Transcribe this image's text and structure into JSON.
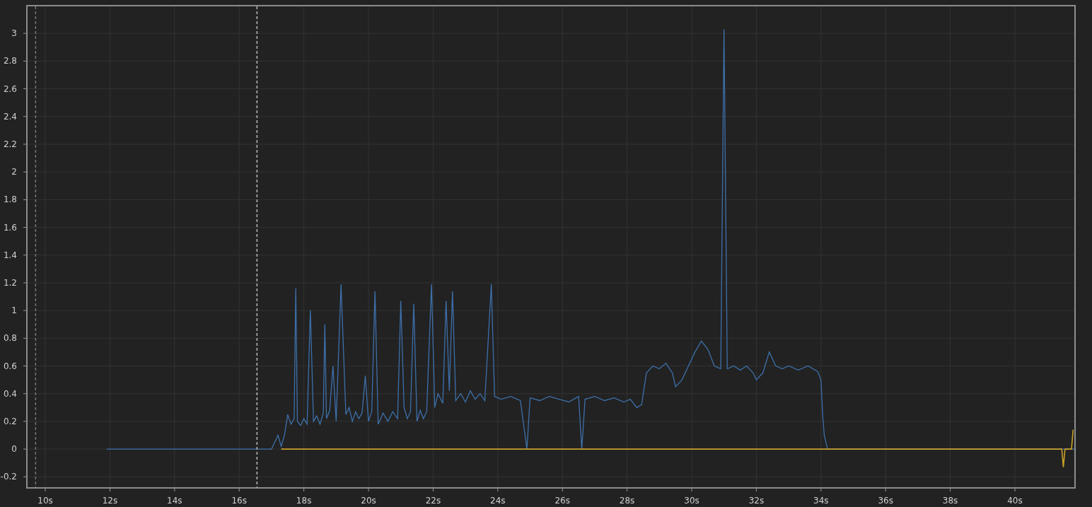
{
  "chart_data": {
    "type": "line",
    "x": [
      11.9,
      17.0,
      17.2,
      17.3,
      17.4,
      17.5,
      17.6,
      17.7,
      17.75,
      17.8,
      17.9,
      18.0,
      18.1,
      18.2,
      18.3,
      18.4,
      18.5,
      18.6,
      18.65,
      18.7,
      18.8,
      18.9,
      19.0,
      19.15,
      19.3,
      19.4,
      19.5,
      19.6,
      19.7,
      19.8,
      19.9,
      20.0,
      20.1,
      20.2,
      20.3,
      20.45,
      20.6,
      20.75,
      20.9,
      21.0,
      21.1,
      21.2,
      21.3,
      21.4,
      21.5,
      21.6,
      21.7,
      21.8,
      21.95,
      22.05,
      22.15,
      22.3,
      22.4,
      22.5,
      22.6,
      22.7,
      22.85,
      23.0,
      23.15,
      23.3,
      23.45,
      23.6,
      23.8,
      23.9,
      24.1,
      24.4,
      24.7,
      24.9,
      25.0,
      25.3,
      25.6,
      25.9,
      26.2,
      26.5,
      26.6,
      26.7,
      27.0,
      27.3,
      27.6,
      27.9,
      28.1,
      28.3,
      28.45,
      28.6,
      28.8,
      29.0,
      29.2,
      29.4,
      29.5,
      29.7,
      29.9,
      30.1,
      30.3,
      30.5,
      30.7,
      30.9,
      31.0,
      31.1,
      31.3,
      31.5,
      31.7,
      31.9,
      32.0,
      32.2,
      32.4,
      32.6,
      32.8,
      33.0,
      33.3,
      33.6,
      33.9,
      34.0,
      34.05,
      34.1,
      34.2,
      41.45,
      41.5,
      41.55,
      41.75,
      41.8,
      41.85
    ],
    "series": [
      {
        "color": "#3d70aa",
        "values": [
          0,
          0,
          0.1,
          0.02,
          0.1,
          0.25,
          0.18,
          0.22,
          1.16,
          0.2,
          0.17,
          0.22,
          0.18,
          1.0,
          0.2,
          0.24,
          0.18,
          0.26,
          0.9,
          0.22,
          0.28,
          0.6,
          0.2,
          1.19,
          0.25,
          0.3,
          0.2,
          0.27,
          0.22,
          0.26,
          0.53,
          0.2,
          0.27,
          1.14,
          0.18,
          0.26,
          0.2,
          0.27,
          0.22,
          1.07,
          0.3,
          0.22,
          0.27,
          1.05,
          0.2,
          0.28,
          0.22,
          0.27,
          1.19,
          0.3,
          0.4,
          0.33,
          1.07,
          0.42,
          1.14,
          0.35,
          0.4,
          0.34,
          0.42,
          0.36,
          0.4,
          0.35,
          1.19,
          0.38,
          0.36,
          0.38,
          0.35,
          0,
          0.37,
          0.35,
          0.38,
          0.36,
          0.34,
          0.38,
          0,
          0.36,
          0.38,
          0.35,
          0.37,
          0.34,
          0.36,
          0.3,
          0.32,
          0.55,
          0.6,
          0.58,
          0.62,
          0.55,
          0.45,
          0.5,
          0.6,
          0.7,
          0.78,
          0.72,
          0.6,
          0.58,
          3.03,
          0.58,
          0.6,
          0.57,
          0.6,
          0.55,
          0.5,
          0.55,
          0.7,
          0.6,
          0.58,
          0.6,
          0.57,
          0.6,
          0.56,
          0.5,
          0.25,
          0.1,
          0,
          0,
          0,
          0,
          0,
          0,
          0
        ]
      },
      {
        "color": "#c9a02a",
        "values": [
          null,
          null,
          null,
          0,
          0,
          0,
          0,
          0,
          0,
          0,
          0,
          0,
          0,
          0,
          0,
          0,
          0,
          0,
          0,
          0,
          0,
          0,
          0,
          0,
          0,
          0,
          0,
          0,
          0,
          0,
          0,
          0,
          0,
          0,
          0,
          0,
          0,
          0,
          0,
          0,
          0,
          0,
          0,
          0,
          0,
          0,
          0,
          0,
          0,
          0,
          0,
          0,
          0,
          0,
          0,
          0,
          0,
          0,
          0,
          0,
          0,
          0,
          0,
          0,
          0,
          0,
          0,
          0,
          0,
          0,
          0,
          0,
          0,
          0,
          0,
          0,
          0,
          0,
          0,
          0,
          0,
          0,
          0,
          0,
          0,
          0,
          0,
          0,
          0,
          0,
          0,
          0,
          0,
          0,
          0,
          0,
          0,
          0,
          0,
          0,
          0,
          0,
          0,
          0,
          0,
          0,
          0,
          0,
          0,
          0,
          0,
          0,
          0,
          0,
          0,
          0,
          -0.13,
          0,
          0,
          0.14,
          null
        ]
      }
    ],
    "xlim": [
      9.43,
      41.86
    ],
    "ylim": [
      -0.28,
      3.2
    ],
    "xticks": [
      {
        "value": 10,
        "label": "10s"
      },
      {
        "value": 12,
        "label": "12s"
      },
      {
        "value": 14,
        "label": "14s"
      },
      {
        "value": 16,
        "label": "16s"
      },
      {
        "value": 18,
        "label": "18s"
      },
      {
        "value": 20,
        "label": "20s"
      },
      {
        "value": 22,
        "label": "22s"
      },
      {
        "value": 24,
        "label": "24s"
      },
      {
        "value": 26,
        "label": "26s"
      },
      {
        "value": 28,
        "label": "28s"
      },
      {
        "value": 30,
        "label": "30s"
      },
      {
        "value": 32,
        "label": "32s"
      },
      {
        "value": 34,
        "label": "34s"
      },
      {
        "value": 36,
        "label": "36s"
      },
      {
        "value": 38,
        "label": "38s"
      },
      {
        "value": 40,
        "label": "40s"
      }
    ],
    "yticks": [
      -0.2,
      0,
      0.2,
      0.4,
      0.6,
      0.8,
      1,
      1.2,
      1.4,
      1.6,
      1.8,
      2,
      2.2,
      2.4,
      2.6,
      2.8,
      3
    ],
    "grid": true,
    "ref_lines": [
      {
        "axis": "x",
        "value": 9.7
      },
      {
        "axis": "x",
        "value": 16.55
      }
    ]
  }
}
